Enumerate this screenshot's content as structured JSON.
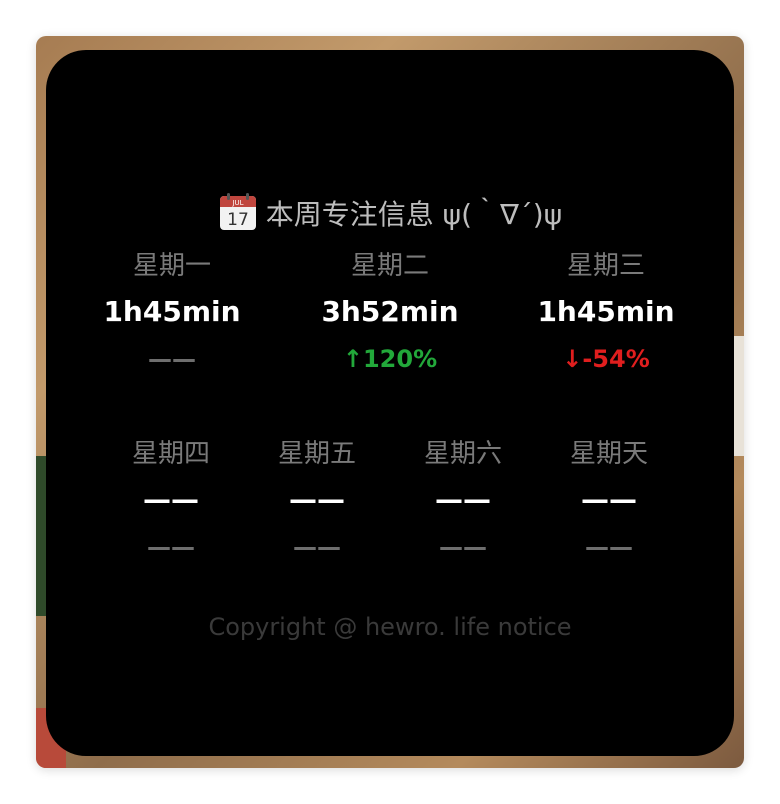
{
  "widget": {
    "title": "本周专注信息 ψ(｀∇´)ψ",
    "calendar_icon_date": "17",
    "calendar_icon_month": "JUL",
    "colors": {
      "up": "#22a83a",
      "down": "#e01e1e",
      "neutral": "#6e6e6e"
    },
    "row1": [
      {
        "day": "星期一",
        "time": "1h45min",
        "change": "——",
        "trend": "neutral"
      },
      {
        "day": "星期二",
        "time": "3h52min",
        "change": "↑120%",
        "trend": "up"
      },
      {
        "day": "星期三",
        "time": "1h45min",
        "change": "↓-54%",
        "trend": "down"
      }
    ],
    "row2": [
      {
        "day": "星期四",
        "time": "——",
        "change": "——",
        "trend": "neutral"
      },
      {
        "day": "星期五",
        "time": "——",
        "change": "——",
        "trend": "neutral"
      },
      {
        "day": "星期六",
        "time": "——",
        "change": "——",
        "trend": "neutral"
      },
      {
        "day": "星期天",
        "time": "——",
        "change": "——",
        "trend": "neutral"
      }
    ],
    "copyright": "Copyright @ hewro. life notice"
  }
}
